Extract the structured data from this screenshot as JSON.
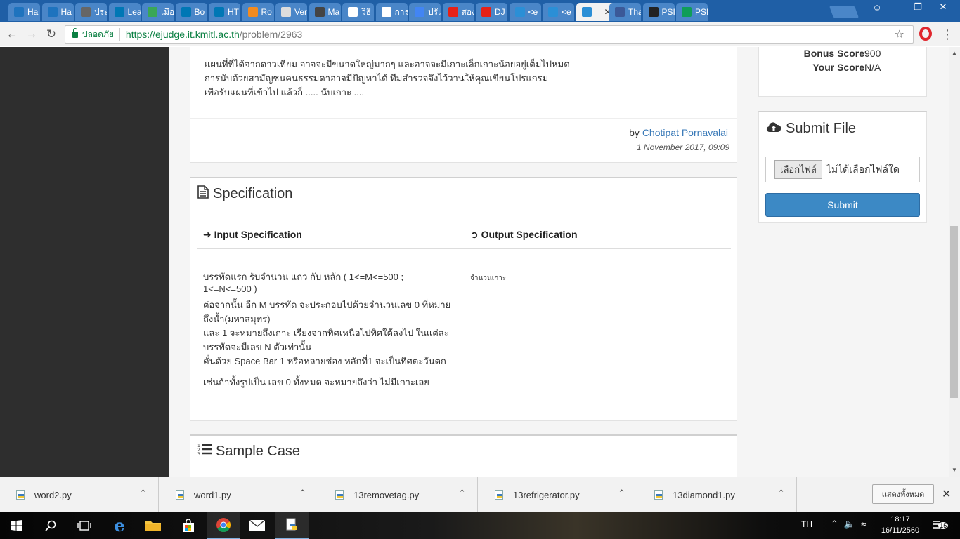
{
  "browser": {
    "tabs": [
      {
        "label": "Ha",
        "icon": "h-icon",
        "color": "#1e73be"
      },
      {
        "label": "Ha",
        "icon": "h-icon",
        "color": "#1e73be"
      },
      {
        "label": "ประ",
        "icon": "history-icon",
        "color": "#666666"
      },
      {
        "label": "Lea",
        "icon": "linkedin-icon",
        "color": "#0077b5"
      },
      {
        "label": "เมือ",
        "icon": "leaf-icon",
        "color": "#3aa757"
      },
      {
        "label": "Bo",
        "icon": "linkedin-icon",
        "color": "#0077b5"
      },
      {
        "label": "HTI",
        "icon": "linkedin-icon",
        "color": "#0077b5"
      },
      {
        "label": "Ro",
        "icon": "runner-icon",
        "color": "#f28b20"
      },
      {
        "label": "Ver",
        "icon": "page-icon",
        "color": "#dddddd"
      },
      {
        "label": "Ma",
        "icon": "code-icon",
        "color": "#444444"
      },
      {
        "label": "วิธี",
        "icon": "google-icon",
        "color": "#ffffff"
      },
      {
        "label": "การ",
        "icon": "google-icon",
        "color": "#ffffff"
      },
      {
        "label": "ปรัเ",
        "icon": "docs-icon",
        "color": "#4285f4"
      },
      {
        "label": "สอง",
        "icon": "youtube-icon",
        "color": "#e62117"
      },
      {
        "label": "DJ",
        "icon": "youtube-icon",
        "color": "#e62117"
      },
      {
        "label": "<e",
        "icon": "ejudge-icon",
        "color": "#2b8fd6"
      },
      {
        "label": "<e",
        "icon": "ejudge-icon",
        "color": "#2b8fd6"
      },
      {
        "label": "",
        "icon": "ejudge-icon",
        "color": "#2b8fd6",
        "active": true
      },
      {
        "label": "Tha",
        "icon": "facebook-icon",
        "color": "#3b5998"
      },
      {
        "label": "PSI",
        "icon": "github-icon",
        "color": "#222222"
      },
      {
        "label": "PSI",
        "icon": "drive-icon",
        "color": "#0f9d58"
      }
    ],
    "secure_label": "ปลอดภัย",
    "url_scheme": "https://",
    "url_host": "ejudge.it.kmitl.ac.th",
    "url_path": "/problem/2963"
  },
  "description": {
    "lines": [
      "แผนที่ที่ได้จากดาวเทียม อาจจะมีขนาดใหญ่มากๆ และอาจจะมีเกาะเล็กเกาะน้อยอยู่เต็มไปหมด",
      "การนับด้วยสามัญชนคนธรรมดาอาจมีปัญหาได้ ทีมสำรวจจึงไว้วานให้คุณเขียนโปรแกรม",
      "เพื่อรับแผนที่เข้าไป แล้วก็ ..... นับเกาะ ...."
    ],
    "by_prefix": "by ",
    "author": "Chotipat Pornavalai",
    "date": "1 November 2017, 09:09"
  },
  "specification": {
    "title": "Specification",
    "input_heading": "Input Specification",
    "output_heading": "Output Specification",
    "input_lines": [
      "บรรทัดแรก รับจำนวน แถว กับ หลัก ( 1<=M<=500 ;",
      "1<=N<=500 )",
      "ต่อจากนั้น อีก M บรรทัด จะประกอบไปด้วยจำนวนเลข 0 ที่หมาย",
      "ถึงน้ำ(มหาสมุทร)",
      "และ 1 จะหมายถึงเกาะ เรียงจากทิศเหนือไปทิศใต้ลงไป ในแต่ละ",
      "บรรทัดจะมีเลข N ตัวเท่านั้น",
      "คั่นด้วย Space Bar 1 หรือหลายช่อง หลักที่1 จะเป็นทิศตะวันตก",
      "เช่นถ้าทั้งรูปเป็น เลข 0 ทั้งหมด จะหมายถึงว่า ไม่มีเกาะเลย"
    ],
    "output_value": "จำนวนเกาะ"
  },
  "sample": {
    "title": "Sample Case"
  },
  "score": {
    "bonus_label": "Bonus Score",
    "bonus_value": "900",
    "your_label": "Your Score",
    "your_value": "N/A"
  },
  "submit": {
    "title": "Submit File",
    "choose_label": "เลือกไฟล์",
    "no_file": "ไม่ได้เลือกไฟล์ใด",
    "button": "Submit"
  },
  "downloads": {
    "items": [
      "word2.py",
      "word1.py",
      "13removetag.py",
      "13refrigerator.py",
      "13diamond1.py"
    ],
    "show_all": "แสดงทั้งหมด"
  },
  "taskbar": {
    "lang": "TH",
    "time": "18:17",
    "date": "16/11/2560",
    "notifications": "15"
  }
}
